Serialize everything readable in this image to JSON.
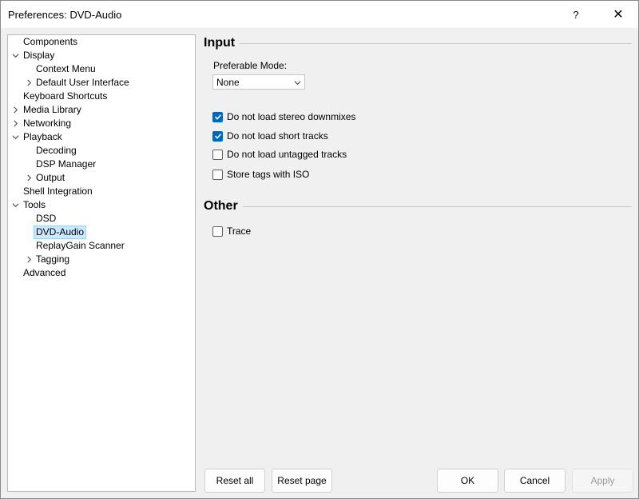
{
  "window": {
    "title": "Preferences: DVD-Audio",
    "help_label": "?",
    "close_label": "✕"
  },
  "tree": {
    "items": [
      {
        "label": "Components"
      },
      {
        "label": "Display"
      },
      {
        "label": "Context Menu"
      },
      {
        "label": "Default User Interface"
      },
      {
        "label": "Keyboard Shortcuts"
      },
      {
        "label": "Media Library"
      },
      {
        "label": "Networking"
      },
      {
        "label": "Playback"
      },
      {
        "label": "Decoding"
      },
      {
        "label": "DSP Manager"
      },
      {
        "label": "Output"
      },
      {
        "label": "Shell Integration"
      },
      {
        "label": "Tools"
      },
      {
        "label": "DSD"
      },
      {
        "label": "DVD-Audio"
      },
      {
        "label": "ReplayGain Scanner"
      },
      {
        "label": "Tagging"
      },
      {
        "label": "Advanced"
      }
    ],
    "selected": "DVD-Audio"
  },
  "input_section": {
    "heading": "Input",
    "mode_label": "Preferable Mode:",
    "mode_value": "None",
    "checkboxes": [
      {
        "label": "Do not load stereo downmixes",
        "checked": true
      },
      {
        "label": "Do not load short tracks",
        "checked": true
      },
      {
        "label": "Do not load untagged tracks",
        "checked": false
      },
      {
        "label": "Store tags with ISO",
        "checked": false
      }
    ]
  },
  "other_section": {
    "heading": "Other",
    "checkboxes": [
      {
        "label": "Trace",
        "checked": false
      }
    ]
  },
  "buttons": {
    "reset_all": "Reset all",
    "reset_page": "Reset page",
    "ok": "OK",
    "cancel": "Cancel",
    "apply": "Apply"
  },
  "colors": {
    "accent": "#0067c0",
    "selection": "#cce8ff"
  }
}
